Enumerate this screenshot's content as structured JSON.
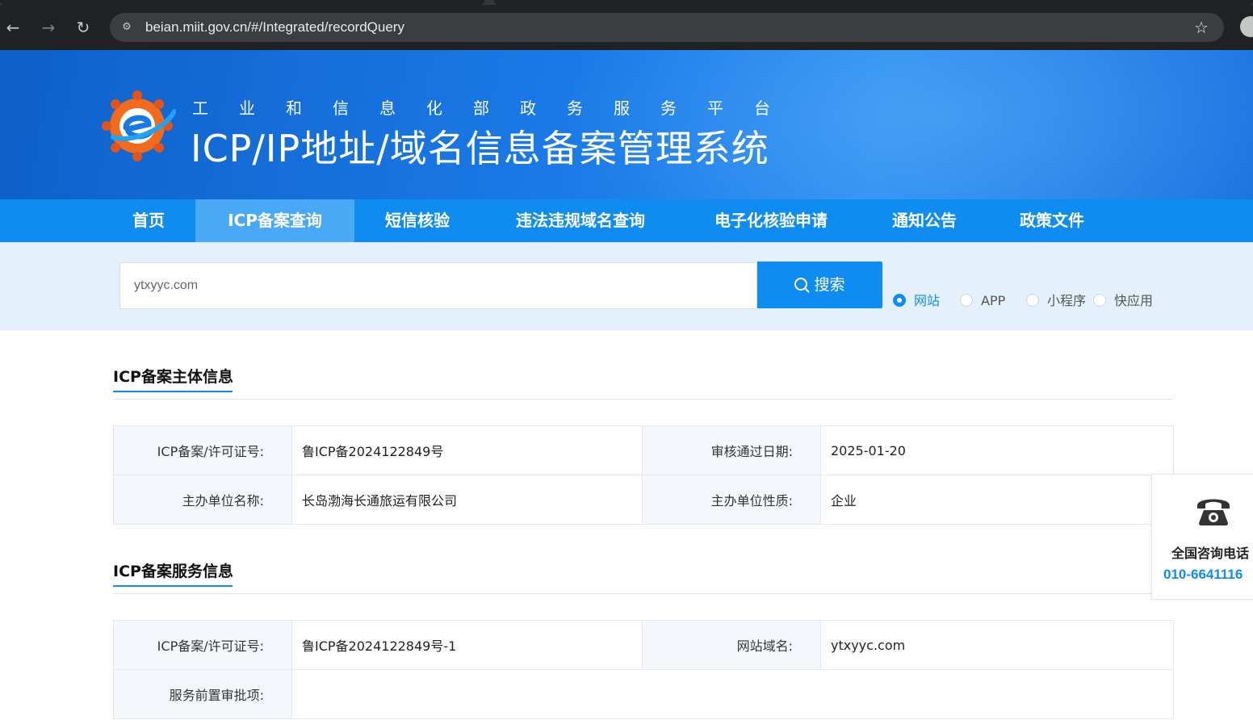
{
  "browser": {
    "url": "beian.miit.gov.cn/#/Integrated/recordQuery",
    "back_icon": "arrow-left-icon",
    "forward_icon": "arrow-right-icon",
    "reload_icon": "reload-icon",
    "bookmark_icon": "star-icon"
  },
  "header": {
    "subtitle": "工业和信息化部政务服务平台",
    "title": "ICP/IP地址/域名信息备案管理系统"
  },
  "nav": {
    "items": [
      {
        "label": "首页"
      },
      {
        "label": "ICP备案查询"
      },
      {
        "label": "短信核验"
      },
      {
        "label": "违法违规域名查询"
      },
      {
        "label": "电子化核验申请"
      },
      {
        "label": "通知公告"
      },
      {
        "label": "政策文件"
      }
    ],
    "active": "ICP备案查询"
  },
  "search": {
    "value": "ytxyyc.com",
    "button_label": "搜索",
    "options": [
      {
        "label": "网站",
        "checked": true
      },
      {
        "label": "APP",
        "checked": false
      },
      {
        "label": "小程序",
        "checked": false
      },
      {
        "label": "快应用",
        "checked": false
      }
    ]
  },
  "entity_section": {
    "title": "ICP备案主体信息",
    "rows": [
      {
        "label1": "ICP备案/许可证号:",
        "value1": "鲁ICP备2024122849号",
        "label2": "审核通过日期:",
        "value2": "2025-01-20"
      },
      {
        "label1": "主办单位名称:",
        "value1": "长岛渤海长通旅运有限公司",
        "label2": "主办单位性质:",
        "value2": "企业"
      }
    ]
  },
  "service_section": {
    "title": "ICP备案服务信息",
    "rows": [
      {
        "label1": "ICP备案/许可证号:",
        "value1": "鲁ICP备2024122849号-1",
        "label2": "网站域名:",
        "value2": "ytxyyc.com"
      },
      {
        "label1": "服务前置审批项:",
        "value1": ""
      }
    ]
  },
  "consult": {
    "icon": "telephone-icon",
    "title": "全国咨询电话",
    "phone": "010-6641116"
  },
  "colors": {
    "primary": "#0e8cf2",
    "nav_active": "#4aa9f6",
    "search_bg": "#e4f1fd",
    "label_bg": "#f4f8fc"
  }
}
